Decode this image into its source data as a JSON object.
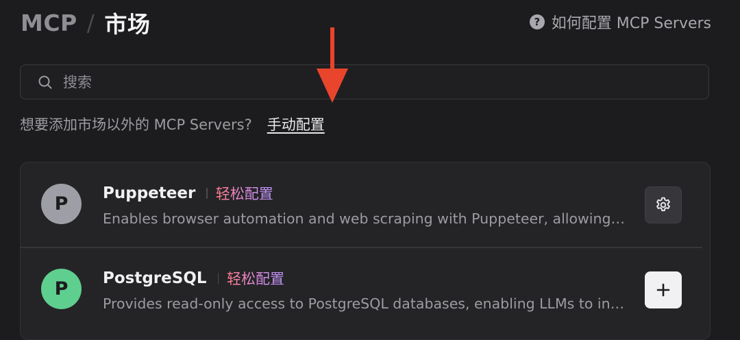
{
  "header": {
    "breadcrumb_parent": "MCP",
    "breadcrumb_separator": "/",
    "breadcrumb_current": "市场",
    "help_icon": "question-circle-icon",
    "help_link": "如何配置 MCP Servers"
  },
  "search": {
    "placeholder": "搜索",
    "value": "",
    "icon": "search-icon"
  },
  "manual": {
    "prompt": "想要添加市场以外的 MCP Servers?",
    "link": "手动配置"
  },
  "annotation": {
    "arrow_color": "#e8452c"
  },
  "servers": [
    {
      "avatar_letter": "P",
      "avatar_color": "#9e9ea6",
      "name": "Puppeteer",
      "tag": "轻松配置",
      "description": "Enables browser automation and web scraping with Puppeteer, allowing LLMs to interact with web pages",
      "action": "settings",
      "action_icon": "gear-icon"
    },
    {
      "avatar_letter": "P",
      "avatar_color": "#5fcf8f",
      "name": "PostgreSQL",
      "tag": "轻松配置",
      "description": "Provides read-only access to PostgreSQL databases, enabling LLMs to inspect database schemas",
      "action": "add",
      "action_icon": "plus-icon"
    }
  ],
  "colors": {
    "background": "#1c1c1e",
    "card": "#242427",
    "tag_gradient_start": "#ff7a8a",
    "tag_gradient_end": "#b794f4"
  }
}
